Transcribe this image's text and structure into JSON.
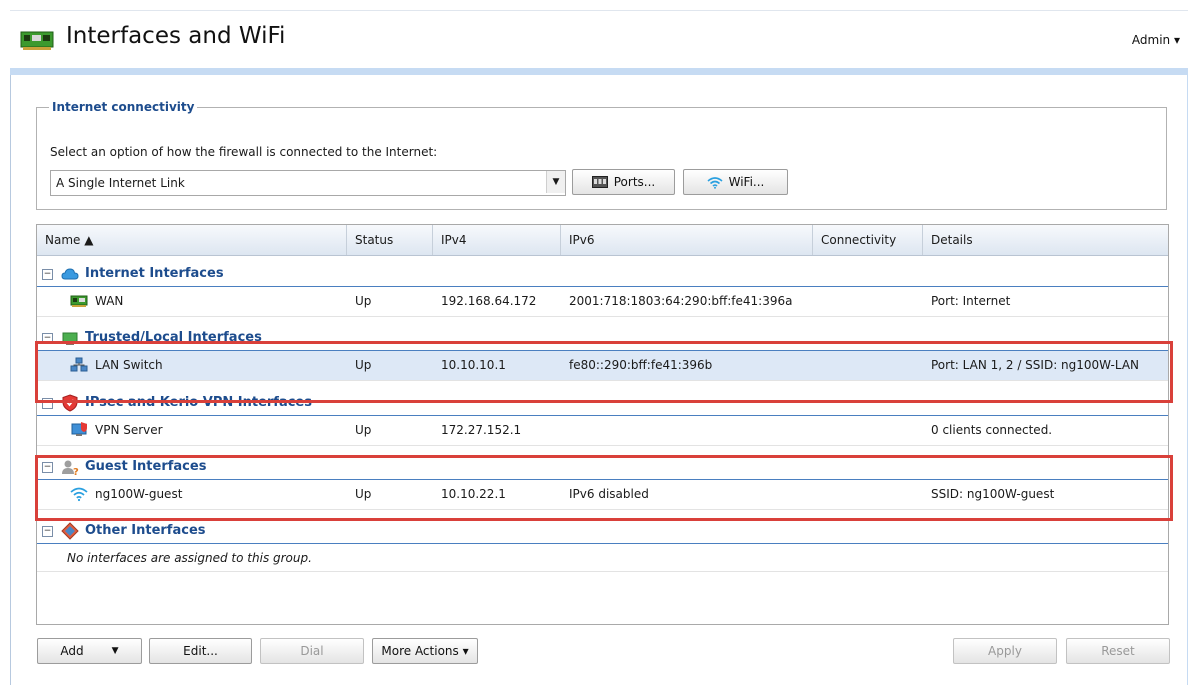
{
  "header": {
    "title": "Interfaces and WiFi",
    "user_menu": "Admin ▾"
  },
  "connectivity": {
    "legend": "Internet connectivity",
    "prompt": "Select an option of how the firewall is connected to the Internet:",
    "selected_option": "A Single Internet Link",
    "ports_button": "Ports...",
    "wifi_button": "WiFi..."
  },
  "table": {
    "columns": [
      "Name ▲",
      "Status",
      "IPv4",
      "IPv6",
      "Connectivity",
      "Details"
    ],
    "groups": [
      {
        "label": "Internet Interfaces",
        "icon": "cloud-icon",
        "rows": [
          {
            "name": "WAN",
            "icon": "network-card-icon",
            "status": "Up",
            "ipv4": "192.168.64.172",
            "ipv6": "2001:718:1803:64:290:bff:fe41:396a",
            "connectivity": "",
            "details": "Port: Internet"
          }
        ]
      },
      {
        "label": "Trusted/Local Interfaces",
        "icon": "trusted-network-icon",
        "rows": [
          {
            "name": "LAN Switch",
            "icon": "switch-icon",
            "status": "Up",
            "ipv4": "10.10.10.1",
            "ipv6": "fe80::290:bff:fe41:396b",
            "connectivity": "",
            "details": "Port: LAN 1, 2 / SSID: ng100W-LAN"
          }
        ]
      },
      {
        "label": "IPsec and Kerio VPN Interfaces",
        "icon": "vpn-shield-icon",
        "rows": [
          {
            "name": "VPN Server",
            "icon": "vpn-server-icon",
            "status": "Up",
            "ipv4": "172.27.152.1",
            "ipv6": "",
            "connectivity": "",
            "details": "0 clients connected."
          }
        ]
      },
      {
        "label": "Guest Interfaces",
        "icon": "guest-user-icon",
        "rows": [
          {
            "name": "ng100W-guest",
            "icon": "wifi-icon",
            "status": "Up",
            "ipv4": "10.10.22.1",
            "ipv6": "IPv6 disabled",
            "connectivity": "",
            "details": "SSID: ng100W-guest"
          }
        ]
      },
      {
        "label": "Other Interfaces",
        "icon": "other-interfaces-icon",
        "empty_text": "No interfaces are assigned to this group."
      }
    ]
  },
  "footer": {
    "add_button": "Add",
    "edit_button": "Edit...",
    "dial_button": "Dial",
    "more_actions_button": "More Actions ▾",
    "apply_button": "Apply",
    "reset_button": "Reset"
  },
  "colors": {
    "group_label": "#1d4c8d",
    "highlight_box": "#d9403a",
    "panel_background": "#c6dbf3",
    "selected_row": "#dde8f6"
  }
}
